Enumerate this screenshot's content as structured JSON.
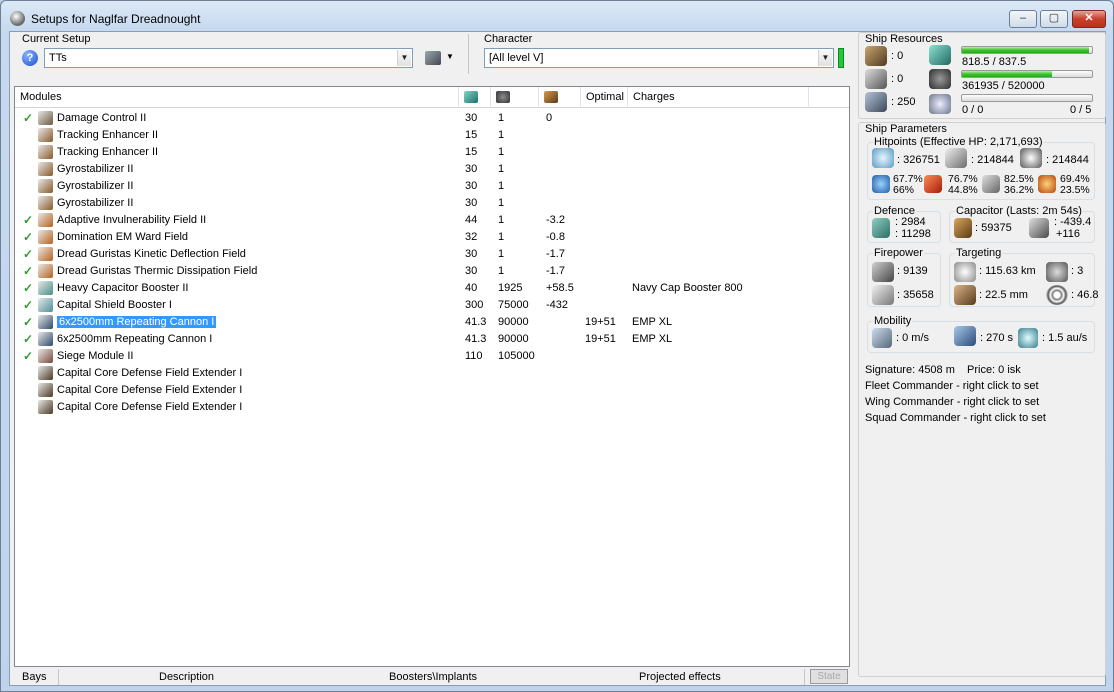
{
  "window": {
    "title": "Setups for Naglfar Dreadnought",
    "min": "‒",
    "max": "▢",
    "close": "✕"
  },
  "setup": {
    "label": "Current Setup",
    "value": "TTs",
    "help": "?"
  },
  "character": {
    "label": "Character",
    "value": "[All level V]"
  },
  "columns": {
    "modules": "Modules",
    "optimal": "Optimal",
    "charges": "Charges"
  },
  "modules": [
    {
      "check": true,
      "name": "Damage Control II",
      "cpu": "30",
      "pg": "1",
      "cap": "0",
      "optimal": "",
      "charges": "",
      "icon": "#6b5a3c"
    },
    {
      "check": false,
      "name": "Tracking Enhancer II",
      "cpu": "15",
      "pg": "1",
      "cap": "",
      "optimal": "",
      "charges": "",
      "icon": "#8a5a2a"
    },
    {
      "check": false,
      "name": "Tracking Enhancer II",
      "cpu": "15",
      "pg": "1",
      "cap": "",
      "optimal": "",
      "charges": "",
      "icon": "#8a5a2a"
    },
    {
      "check": false,
      "name": "Gyrostabilizer II",
      "cpu": "30",
      "pg": "1",
      "cap": "",
      "optimal": "",
      "charges": "",
      "icon": "#8a5a2a"
    },
    {
      "check": false,
      "name": "Gyrostabilizer II",
      "cpu": "30",
      "pg": "1",
      "cap": "",
      "optimal": "",
      "charges": "",
      "icon": "#8a5a2a"
    },
    {
      "check": false,
      "name": "Gyrostabilizer II",
      "cpu": "30",
      "pg": "1",
      "cap": "",
      "optimal": "",
      "charges": "",
      "icon": "#8a5a2a"
    },
    {
      "check": true,
      "name": "Adaptive Invulnerability Field II",
      "cpu": "44",
      "pg": "1",
      "cap": "-3.2",
      "optimal": "",
      "charges": "",
      "icon": "#b8621c"
    },
    {
      "check": true,
      "name": "Domination EM Ward Field",
      "cpu": "32",
      "pg": "1",
      "cap": "-0.8",
      "optimal": "",
      "charges": "",
      "icon": "#b8621c"
    },
    {
      "check": true,
      "name": "Dread Guristas Kinetic Deflection Field",
      "cpu": "30",
      "pg": "1",
      "cap": "-1.7",
      "optimal": "",
      "charges": "",
      "icon": "#b8621c"
    },
    {
      "check": true,
      "name": "Dread Guristas Thermic Dissipation Field",
      "cpu": "30",
      "pg": "1",
      "cap": "-1.7",
      "optimal": "",
      "charges": "",
      "icon": "#b8621c"
    },
    {
      "check": true,
      "name": "Heavy Capacitor Booster II",
      "cpu": "40",
      "pg": "1925",
      "cap": "+58.5",
      "optimal": "",
      "charges": "Navy Cap Booster 800",
      "icon": "#4a8f86"
    },
    {
      "check": true,
      "name": "Capital Shield Booster I",
      "cpu": "300",
      "pg": "75000",
      "cap": "-432",
      "optimal": "",
      "charges": "",
      "icon": "#4b8f99"
    },
    {
      "check": true,
      "name": "6x2500mm Repeating Cannon I",
      "cpu": "41.3",
      "pg": "90000",
      "cap": "",
      "optimal": "19+51",
      "charges": "EMP XL",
      "icon": "#2f4a6b",
      "selected": true
    },
    {
      "check": true,
      "name": "6x2500mm Repeating Cannon I",
      "cpu": "41.3",
      "pg": "90000",
      "cap": "",
      "optimal": "19+51",
      "charges": "EMP XL",
      "icon": "#2f4a6b"
    },
    {
      "check": true,
      "name": "Siege Module II",
      "cpu": "110",
      "pg": "105000",
      "cap": "",
      "optimal": "",
      "charges": "",
      "icon": "#7a4a3a"
    },
    {
      "check": false,
      "name": "Capital Core Defense Field Extender I",
      "cpu": "",
      "pg": "",
      "cap": "",
      "optimal": "",
      "charges": "",
      "icon": "#4a3a22"
    },
    {
      "check": false,
      "name": "Capital Core Defense Field Extender I",
      "cpu": "",
      "pg": "",
      "cap": "",
      "optimal": "",
      "charges": "",
      "icon": "#4a3a22"
    },
    {
      "check": false,
      "name": "Capital Core Defense Field Extender I",
      "cpu": "",
      "pg": "",
      "cap": "",
      "optimal": "",
      "charges": "",
      "icon": "#4a3a22"
    }
  ],
  "tabs": {
    "bays": "Bays",
    "description": "Description",
    "boosters": "Boosters\\Implants",
    "projected": "Projected effects",
    "state": "State"
  },
  "resources": {
    "title": "Ship Resources",
    "turrets": ": 0",
    "launchers": ": 0",
    "calibration": ": 250",
    "cpu_text": "818.5 / 837.5",
    "cpu_fraction": 0.977,
    "pg_text": "361935 / 520000",
    "pg_fraction": 0.696,
    "drone_bw": "0 / 0",
    "drone_count": "0 / 5",
    "drone_fraction": 0
  },
  "params": {
    "title": "Ship Parameters",
    "hitpoints_title": "Hitpoints (Effective HP: 2,171,693)",
    "shield_hp": ": 326751",
    "armor_hp": ": 214844",
    "structure_hp": ": 214844",
    "em": [
      "67.7%",
      "66%"
    ],
    "thermal": [
      "76.7%",
      "44.8%"
    ],
    "kinetic": [
      "82.5%",
      "36.2%"
    ],
    "explosive": [
      "69.4%",
      "23.5%"
    ],
    "defence_title": "Defence",
    "def1": ": 2984",
    "def2": ": 11298",
    "cap_title": "Capacitor (Lasts: 2m 54s)",
    "cap_amount": ": 59375",
    "cap_rate1": ": -439.4",
    "cap_rate2": "+116",
    "firepower_title": "Firepower",
    "fp1": ": 9139",
    "fp2": ": 35658",
    "targeting_title": "Targeting",
    "range": ": 115.63 km",
    "targets": ": 3",
    "scanres": ": 22.5 mm",
    "sensor": ": 46.8",
    "mobility_title": "Mobility",
    "speed": ": 0 m/s",
    "align": ": 270 s",
    "warp": ": 1.5 au/s"
  },
  "footer": {
    "signature": "Signature: 4508 m",
    "price": "Price: 0 isk",
    "fleet": "Fleet Commander - right click to set",
    "wing": "Wing Commander - right click to set",
    "squad": "Squad Commander - right click to set"
  }
}
